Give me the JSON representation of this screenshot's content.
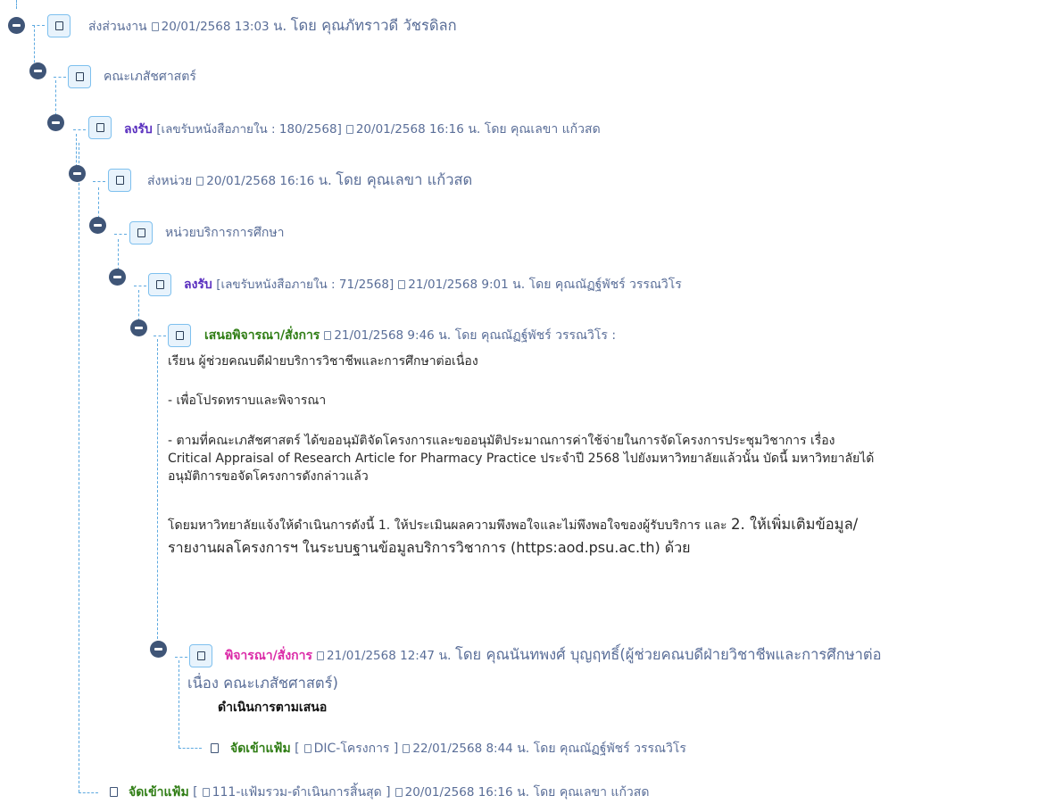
{
  "nodes": [
    {
      "action": "ส่งส่วนงาน",
      "datetime": "20/01/2568 13:03",
      "unit": "น.",
      "by": "โดย คุณภัทราวดี วัชรดิลก"
    },
    {
      "org": "คณะเภสัชศาสตร์"
    },
    {
      "action": "ลงรับ",
      "ref": "[เลขรับหนังสือภายใน : 180/2568]",
      "datetime": "20/01/2568 16:16",
      "unit": "น.",
      "by": "โดย คุณเลขา แก้วสด"
    },
    {
      "action": "ส่งหน่วย",
      "datetime": "20/01/2568 16:16",
      "unit": "น.",
      "by": "โดย คุณเลขา แก้วสด"
    },
    {
      "org": "หน่วยบริการการศึกษา"
    },
    {
      "action": "ลงรับ",
      "ref": "[เลขรับหนังสือภายใน : 71/2568]",
      "datetime": "21/01/2568 9:01",
      "unit": "น.",
      "by": "โดย คุณณัฏฐ์พัชร์ วรรณวิโร"
    },
    {
      "action": "เสนอพิจารณา/สั่งการ",
      "datetime": "21/01/2568 9:46",
      "unit": "น.",
      "by": "โดย คุณณัฏฐ์พัชร์ วรรณวิโร :",
      "message": {
        "line1": "เรียน  ผู้ช่วยคณบดีฝ่ายบริการวิชาชีพและการศึกษาต่อเนื่อง",
        "line2": "- เพื่อโปรดทราบและพิจารณา",
        "line3": "- ตามที่คณะเภสัชศาสตร์ ได้ขออนุมัติจัดโครงการและขออนุมัติประมาณการค่าใช้จ่ายในการจัดโครงการประชุมวิชาการ เรื่อง",
        "line4": "Critical Appraisal of Research Article for Pharmacy Practice ประจำปี 2568 ไปยังมหาวิทยาลัยแล้วนั้น บัดนี้ มหาวิทยาลัยได้",
        "line5": "อนุมัติการขอจัดโครงการดังกล่าวแล้ว",
        "line6a": "โดยมหาวิทยาลัยแจ้งให้ดำเนินการดังนี้  1. ให้ประเมินผลความพึงพอใจและไม่พึงพอใจของผู้รับบริการ และ ",
        "line6b": "2. ให้เพิ่มเติมข้อมูล/",
        "line7": "รายงานผลโครงการฯ ในระบบฐานข้อมูลบริการวิชาการ (https:aod.psu.ac.th) ด้วย"
      }
    },
    {
      "action": "พิจารณา/สั่งการ",
      "datetime": "21/01/2568 12:47",
      "unit": "น.",
      "by_line1": "โดย คุณนันทพงศ์ บุญฤทธิ์(ผู้ช่วยคณบดีฝ่ายวิชาชีพและการศึกษาต่อ",
      "by_line2": "เนื่อง คณะเภสัชศาสตร์)",
      "comment": "ดำเนินการตามเสนอ"
    },
    {
      "action": "จัดเข้าแฟ้ม",
      "folder_open": "[",
      "folder": "DIC-โครงการ ]",
      "datetime": "22/01/2568 8:44",
      "unit": "น.",
      "by": "โดย คุณณัฏฐ์พัชร์ วรรณวิโร"
    },
    {
      "action": "จัดเข้าแฟ้ม",
      "folder_open": "[",
      "folder": "111-แฟ้มรวม-ดำเนินการสิ้นสุด ]",
      "datetime": "20/01/2568 16:16",
      "unit": "น.",
      "by": "โดย คุณเลขา แก้วสด"
    }
  ]
}
